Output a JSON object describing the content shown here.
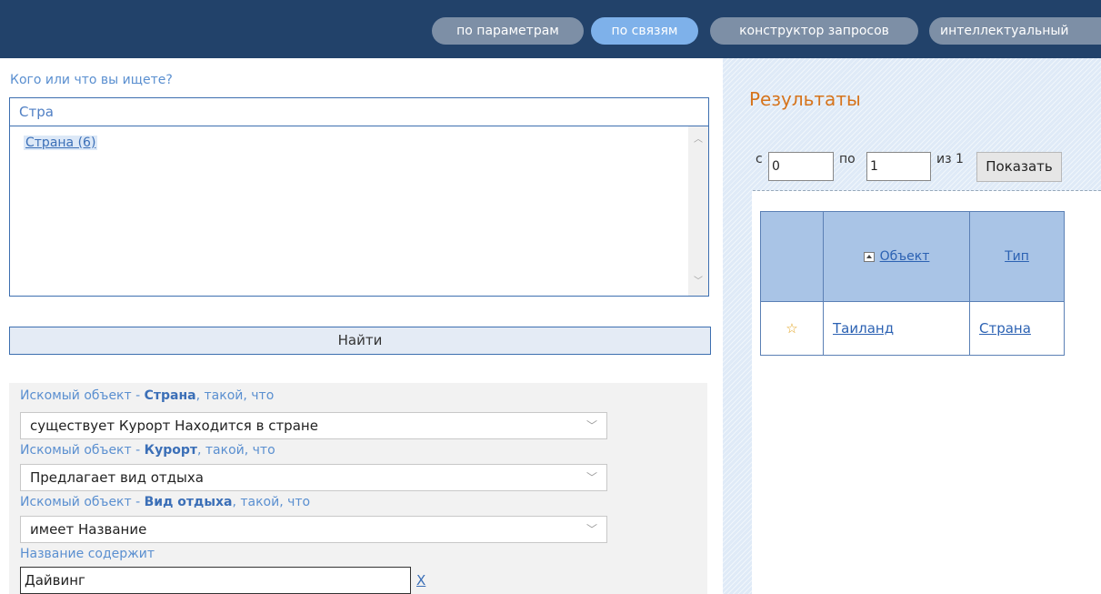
{
  "nav": {
    "tabs": [
      {
        "label": "по параметрам"
      },
      {
        "label": "по связям"
      },
      {
        "label": "конструктор запросов"
      },
      {
        "label": "интеллектуальный"
      }
    ]
  },
  "search": {
    "prompt": "Кого или что вы ищете?",
    "value": "Стра",
    "suggestion": "Страна (6)",
    "find_label": "Найти"
  },
  "criteria": {
    "prefix": "Искомый объект - ",
    "suffix": ", такой, что",
    "rows": [
      {
        "object": "Страна",
        "selected": "существует Курорт Находится в стране"
      },
      {
        "object": "Курорт",
        "selected": "Предлагает вид отдыха"
      },
      {
        "object": "Вид отдыха",
        "selected": "имеет Название"
      }
    ],
    "name_label": "Название содержит",
    "name_value": "Дайвинг",
    "clear_label": "X"
  },
  "results": {
    "title": "Результаты",
    "from_label": "с",
    "from_value": "0",
    "to_label": "по",
    "to_value": "1",
    "of_label": "из 1",
    "show_label": "Показать",
    "columns": {
      "object": "Объект",
      "type": "Тип"
    },
    "rows": [
      {
        "object": "Таиланд",
        "type": "Страна",
        "icon": "star-outline-icon"
      }
    ]
  }
}
